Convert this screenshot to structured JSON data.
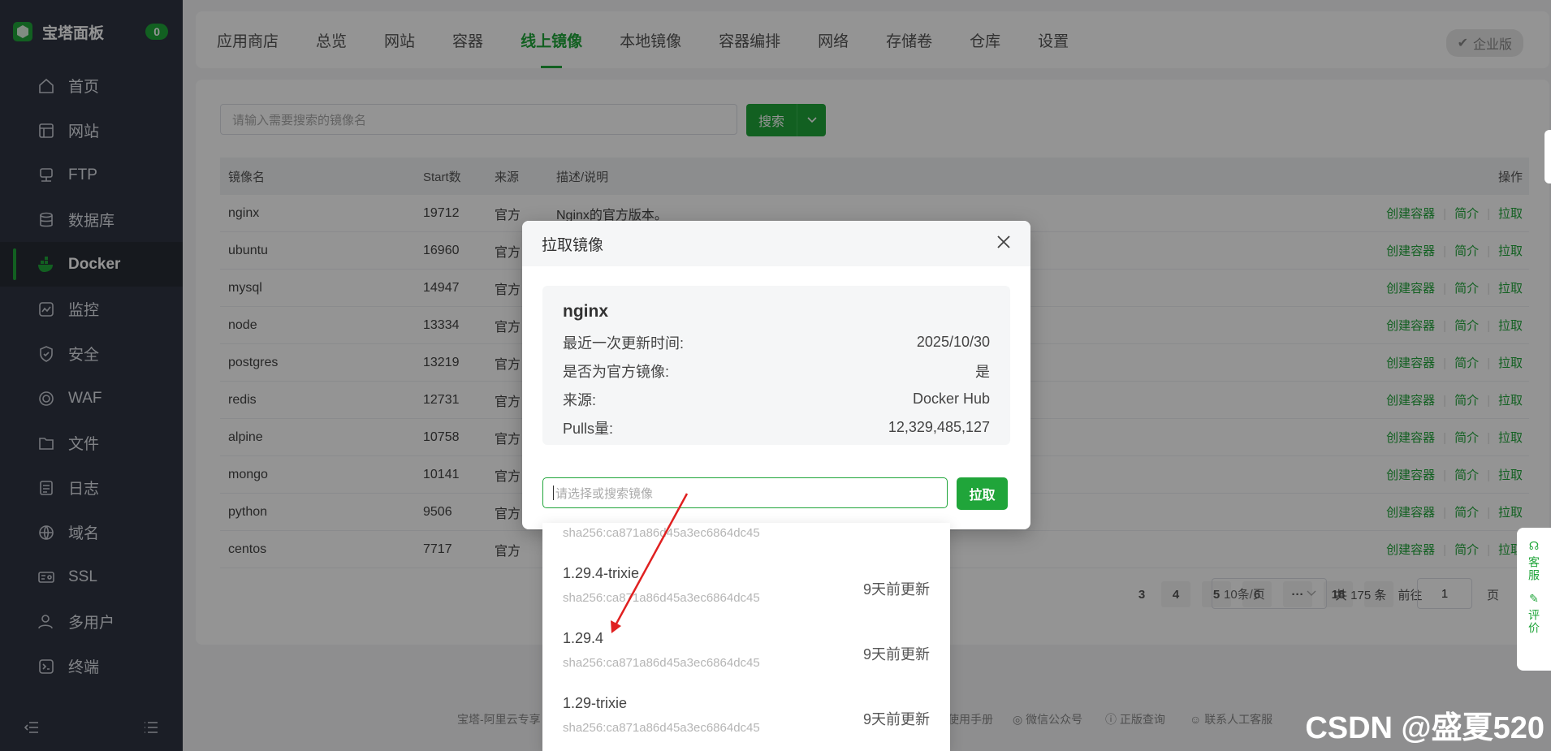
{
  "brand": {
    "title": "宝塔面板",
    "badge": "0"
  },
  "sidebar": {
    "items": [
      {
        "label": "首页"
      },
      {
        "label": "网站"
      },
      {
        "label": "FTP"
      },
      {
        "label": "数据库"
      },
      {
        "label": "Docker"
      },
      {
        "label": "监控"
      },
      {
        "label": "安全"
      },
      {
        "label": "WAF"
      },
      {
        "label": "文件"
      },
      {
        "label": "日志"
      },
      {
        "label": "域名"
      },
      {
        "label": "SSL"
      },
      {
        "label": "多用户"
      },
      {
        "label": "终端"
      }
    ]
  },
  "topnav": {
    "tabs": [
      {
        "label": "应用商店"
      },
      {
        "label": "总览"
      },
      {
        "label": "网站"
      },
      {
        "label": "容器"
      },
      {
        "label": "线上镜像"
      },
      {
        "label": "本地镜像"
      },
      {
        "label": "容器编排"
      },
      {
        "label": "网络"
      },
      {
        "label": "存储卷"
      },
      {
        "label": "仓库"
      },
      {
        "label": "设置"
      }
    ],
    "enterprise": "企业版"
  },
  "search": {
    "placeholder": "请输入需要搜索的镜像名",
    "button": "搜索"
  },
  "table": {
    "headers": {
      "name": "镜像名",
      "stars": "Start数",
      "source": "来源",
      "desc": "描述/说明",
      "ops": "操作"
    },
    "actions": {
      "create": "创建容器",
      "intro": "简介",
      "pull": "拉取"
    },
    "rows": [
      {
        "name": "nginx",
        "stars": "19712",
        "source": "官方",
        "desc": "Nginx的官方版本。"
      },
      {
        "name": "ubuntu",
        "stars": "16960",
        "source": "官方",
        "desc": ""
      },
      {
        "name": "mysql",
        "stars": "14947",
        "source": "官方",
        "desc": ""
      },
      {
        "name": "node",
        "stars": "13334",
        "source": "官方",
        "desc": ""
      },
      {
        "name": "postgres",
        "stars": "13219",
        "source": "官方",
        "desc": ""
      },
      {
        "name": "redis",
        "stars": "12731",
        "source": "官方",
        "desc": ""
      },
      {
        "name": "alpine",
        "stars": "10758",
        "source": "官方",
        "desc": ""
      },
      {
        "name": "mongo",
        "stars": "10141",
        "source": "官方",
        "desc": ""
      },
      {
        "name": "python",
        "stars": "9506",
        "source": "官方",
        "desc": ""
      },
      {
        "name": "centos",
        "stars": "7717",
        "source": "官方",
        "desc": ""
      }
    ]
  },
  "pager": {
    "pages": [
      "3",
      "4",
      "5",
      "6",
      "···",
      "18"
    ],
    "next": "›",
    "per_page": "10条/页",
    "total": "共 175 条",
    "goto_label": "前往",
    "goto_value": "1",
    "page_unit": "页"
  },
  "footer": {
    "left": "宝塔-阿里云专享",
    "links": [
      "使用手册",
      "微信公众号",
      "正版查询",
      "联系人工客服"
    ]
  },
  "side_help": {
    "service": "客服",
    "review": "评价"
  },
  "modal": {
    "title": "拉取镜像",
    "image_name": "nginx",
    "info": [
      {
        "label": "最近一次更新时间:",
        "value": "2025/10/30"
      },
      {
        "label": "是否为官方镜像:",
        "value": "是"
      },
      {
        "label": "来源:",
        "value": "Docker Hub"
      },
      {
        "label": "Pulls量:",
        "value": "12,329,485,127"
      }
    ],
    "input_placeholder": "请选择或搜索镜像",
    "pull_button": "拉取"
  },
  "dropdown": {
    "partial_hash": "sha256:ca871a86d45a3ec6864dc45",
    "options": [
      {
        "name": "1.29.4-trixie",
        "hash": "sha256:ca871a86d45a3ec6864dc45",
        "time": "9天前更新"
      },
      {
        "name": "1.29.4",
        "hash": "sha256:ca871a86d45a3ec6864dc45",
        "time": "9天前更新"
      },
      {
        "name": "1.29-trixie",
        "hash": "sha256:ca871a86d45a3ec6864dc45",
        "time": "9天前更新"
      }
    ]
  },
  "watermark": "CSDN @盛夏520",
  "colors": {
    "accent": "#20a53a",
    "sidebar": "#2f3542",
    "annotation": "#e02020"
  }
}
